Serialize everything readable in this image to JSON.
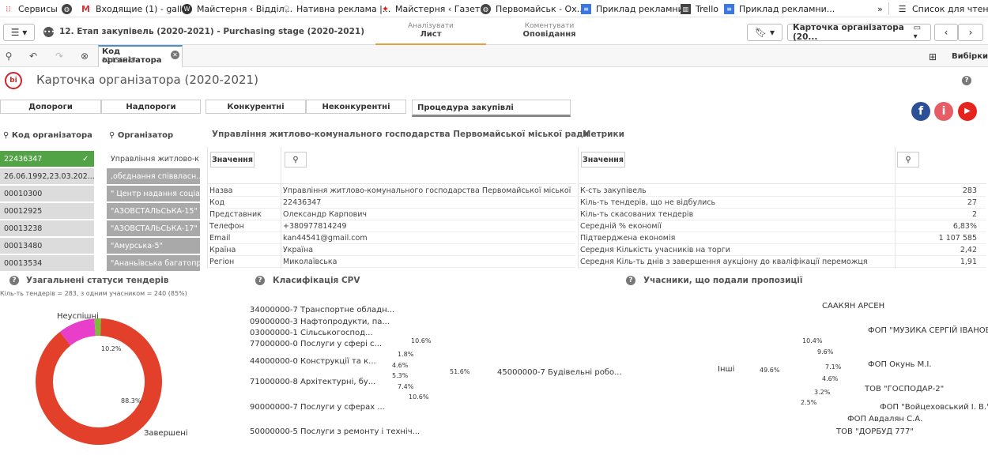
{
  "bookmarks": [
    {
      "label": "Сервисы",
      "icon": "apps-grid-icon"
    },
    {
      "label": "",
      "icon": "globe-icon"
    },
    {
      "label": "Входящие (1) - gall...",
      "icon": "gmail-icon"
    },
    {
      "label": "Майстерня ‹ Відділ...",
      "icon": "wordpress-icon"
    },
    {
      "label": "Нативна реклама |...",
      "icon": "lightbulb-icon"
    },
    {
      "label": "Майстерня ‹ Газет...",
      "icon": "site-icon"
    },
    {
      "label": "Первомайськ - Ох...",
      "icon": "globe-icon"
    },
    {
      "label": "Приклад рекламни...",
      "icon": "docs-icon"
    },
    {
      "label": "Trello",
      "icon": "trello-icon"
    },
    {
      "label": "Приклад рекламни...",
      "icon": "docs-icon"
    }
  ],
  "bookmarks_more": "»",
  "reading_list": "Список для чтения",
  "app_title": "12. Етап закупівель (2020-2021) - Purchasing stage (2020-2021)",
  "tabs": [
    {
      "top": "Аналізувати",
      "bottom": "Лист"
    },
    {
      "top": "Коментувати",
      "bottom": "Оповідання"
    }
  ],
  "sheet_selector": "Карточка організатора (20...",
  "selection_chip": {
    "title": "Код організатора",
    "value": "22436347"
  },
  "selections_label": "Вибірки",
  "sheet_title": "Карточка організатора (2020-2021)",
  "filter_buttons": [
    "Допороги",
    "Надпороги",
    "Конкурентні",
    "Неконкурентні",
    "Процедура закупівлі"
  ],
  "list1": {
    "title": "Код організатора",
    "items": [
      "22436347",
      "26.06.1992,23.03.202...",
      "00010300",
      "00012925",
      "00013238",
      "00013480",
      "00013534"
    ]
  },
  "list2": {
    "title": "Організатор",
    "items": [
      "Управління житлово-к...",
      ",обєднання співвласн...",
      "\" Центр надання соціа...",
      "\"АЗОВСТАЛЬСЬКА-15\"",
      "\"АЗОВСТАЛЬСЬКА-17\"",
      "\"Амурська-5\"",
      "\"Ананьївська багатопр..."
    ]
  },
  "org_panel": {
    "title": "Управління житлово-комунального господарства Первомайської міської ради",
    "values_btn": "Значення",
    "rows": [
      [
        "Назва",
        "Управління житлово-комунального господарства Первомайської міської ради"
      ],
      [
        "Код",
        "22436347"
      ],
      [
        "Представник",
        "Олександр Карпович"
      ],
      [
        "Телефон",
        "+380977814249"
      ],
      [
        "Email",
        "kan44541@gmail.com"
      ],
      [
        "Країна",
        "Україна"
      ],
      [
        "Регіон",
        "Миколаївська"
      ]
    ]
  },
  "metrics_panel": {
    "title": "Метрики",
    "values_btn": "Значення",
    "rows": [
      [
        "К-сть закупівель",
        "283"
      ],
      [
        "Кіль-ть тендерів, що не відбулись",
        "27"
      ],
      [
        "Кіль-ть скасованих тендерів",
        "2"
      ],
      [
        "Середній % економії",
        "6,83%"
      ],
      [
        "Підтверджена економія",
        "1 107 585"
      ],
      [
        "Середня Кількість учасників на торги",
        "2,42"
      ],
      [
        "Середня Кіль-ть днів з завершення аукціону до кваліфікації переможця",
        "1,91"
      ]
    ]
  },
  "statuses": {
    "title": "Узагальнені статуси тендерів",
    "subtitle": "Кіль-ть тендерів = 283, з одним учасником = 240 (85%)",
    "labels": {
      "unsuccessful": "Неуспішні",
      "completed": "Завершені"
    },
    "pct_small": "10.2%",
    "pct_big": "88.3%"
  },
  "cpv": {
    "title": "Класифікація CPV",
    "labels": [
      "34000000-7 Транспортне обладн...",
      "09000000-3 Нафтопродукти, па...",
      "03000000-1 Сільськогоспод...",
      "77000000-0 Послуги у сфері с...",
      "44000000-0 Конструкції та к...",
      "71000000-8 Архітектурні, бу...",
      "90000000-7 Послуги у сферах ...",
      "50000000-5 Послуги з ремонту і техніч...",
      "45000000-7 Будівельні робо..."
    ],
    "pcts": [
      "10.6%",
      "1.8%",
      "4.6%",
      "5.3%",
      "7.4%",
      "10.6%",
      "51.6%"
    ]
  },
  "participants": {
    "title": "Учасники, що подали пропозиції",
    "labels": [
      "СААКЯН АРСЕН",
      "ФОП \"МУЗИКА СЕРГІЙ ІВАНОВ...",
      "ФОП Окунь М.І.",
      "ТОВ \"ГОСПОДАР-2\"",
      "ФОП \"Войцеховський І. В.\"",
      "ФОП Авдалян С.А.",
      "ТОВ \"ДОРБУД 777\"",
      "Інші"
    ],
    "pcts": [
      "10.4%",
      "9.6%",
      "7.1%",
      "4.6%",
      "3.2%",
      "2.5%",
      "49.6%"
    ]
  },
  "colors": {
    "accent": "#52a346",
    "red": "#e2402a",
    "crimson": "#b0163a",
    "blue": "#3565a8",
    "grey": "#a4a4a4"
  }
}
